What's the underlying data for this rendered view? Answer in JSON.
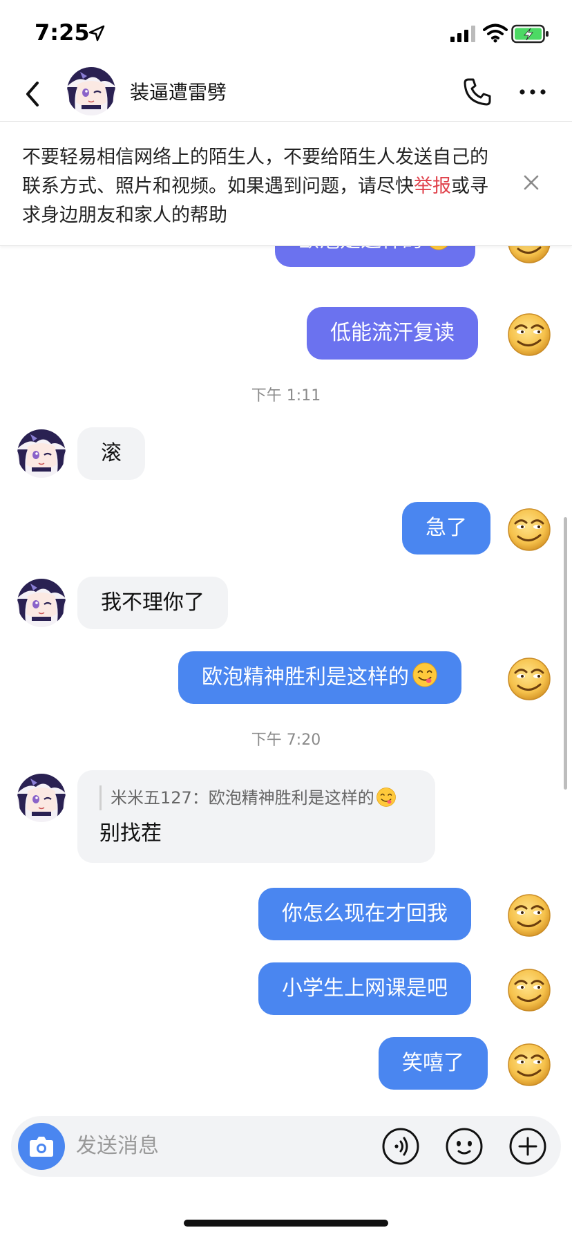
{
  "status_bar": {
    "time": "7:25"
  },
  "header": {
    "contact_name": "装逼遭雷劈"
  },
  "warning": {
    "text_before": "不要轻易相信网络上的陌生人，不要给陌生人发送自己的联系方式、照片和视频。如果遇到问题，请尽快",
    "report_link": "举报",
    "text_after": "或寻求身边朋友和家人的帮助"
  },
  "messages": [
    {
      "side": "out",
      "text": "欧泡是这样的",
      "emoji": "yum-emoji"
    },
    {
      "side": "out",
      "text": "低能流汗复读"
    },
    {
      "type": "time",
      "text": "下午 1:11"
    },
    {
      "side": "in",
      "text": "滚"
    },
    {
      "side": "out",
      "text": "急了"
    },
    {
      "side": "in",
      "text": "我不理你了"
    },
    {
      "side": "out",
      "text": "欧泡精神胜利是这样的",
      "emoji": "yum-emoji"
    },
    {
      "type": "time",
      "text": "下午 7:20"
    },
    {
      "side": "in",
      "quote": "米米五127：欧泡精神胜利是这样的",
      "quote_emoji": "yum-emoji",
      "text": "别找茬"
    },
    {
      "side": "out",
      "text": "你怎么现在才回我"
    },
    {
      "side": "out",
      "text": "小学生上网课是吧"
    },
    {
      "side": "out",
      "text": "笑嘻了"
    }
  ],
  "input": {
    "placeholder": "发送消息"
  },
  "colors": {
    "outgoing": "#4a86f0",
    "outgoing_alt": "#6b72ef",
    "incoming": "#f2f3f5",
    "report": "#e0424c"
  }
}
